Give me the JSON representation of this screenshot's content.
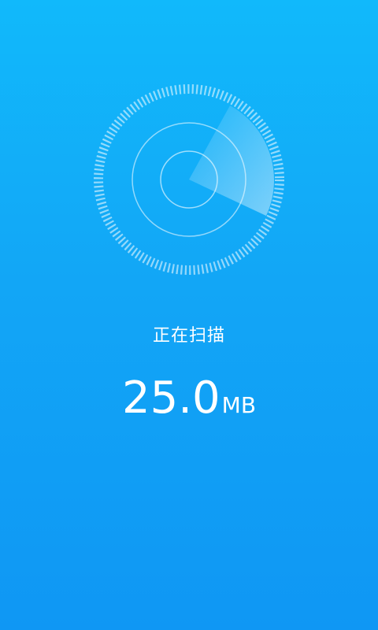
{
  "scanner": {
    "status_label": "正在扫描",
    "scanned_value": "25.0",
    "scanned_unit": "MB",
    "radar_icon": "radar-scan-icon"
  },
  "colors": {
    "background_top": "#11b9fb",
    "background_bottom": "#0f97f4",
    "text": "#ffffff"
  }
}
